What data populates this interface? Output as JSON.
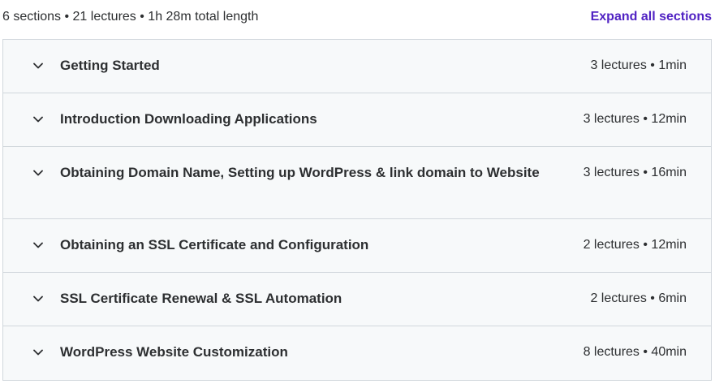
{
  "summary": {
    "text": "6 sections • 21 lectures • 1h 28m total length",
    "expand_label": "Expand all sections"
  },
  "colors": {
    "accent": "#5022c3",
    "row_background": "#f7f9fa",
    "border": "#d1d7dc",
    "text": "#2d2f31"
  },
  "sections": [
    {
      "title": "Getting Started",
      "meta": "3 lectures • 1min",
      "icon": "chevron-down-icon"
    },
    {
      "title": "Introduction Downloading Applications",
      "meta": "3 lectures • 12min",
      "icon": "chevron-down-icon"
    },
    {
      "title": "Obtaining Domain Name, Setting up WordPress & link domain to Website",
      "meta": "3 lectures • 16min",
      "icon": "chevron-down-icon"
    },
    {
      "title": "Obtaining an SSL Certificate and Configuration",
      "meta": "2 lectures • 12min",
      "icon": "chevron-down-icon"
    },
    {
      "title": "SSL Certificate Renewal & SSL Automation",
      "meta": "2 lectures • 6min",
      "icon": "chevron-down-icon"
    },
    {
      "title": "WordPress Website Customization",
      "meta": "8 lectures • 40min",
      "icon": "chevron-down-icon"
    }
  ]
}
